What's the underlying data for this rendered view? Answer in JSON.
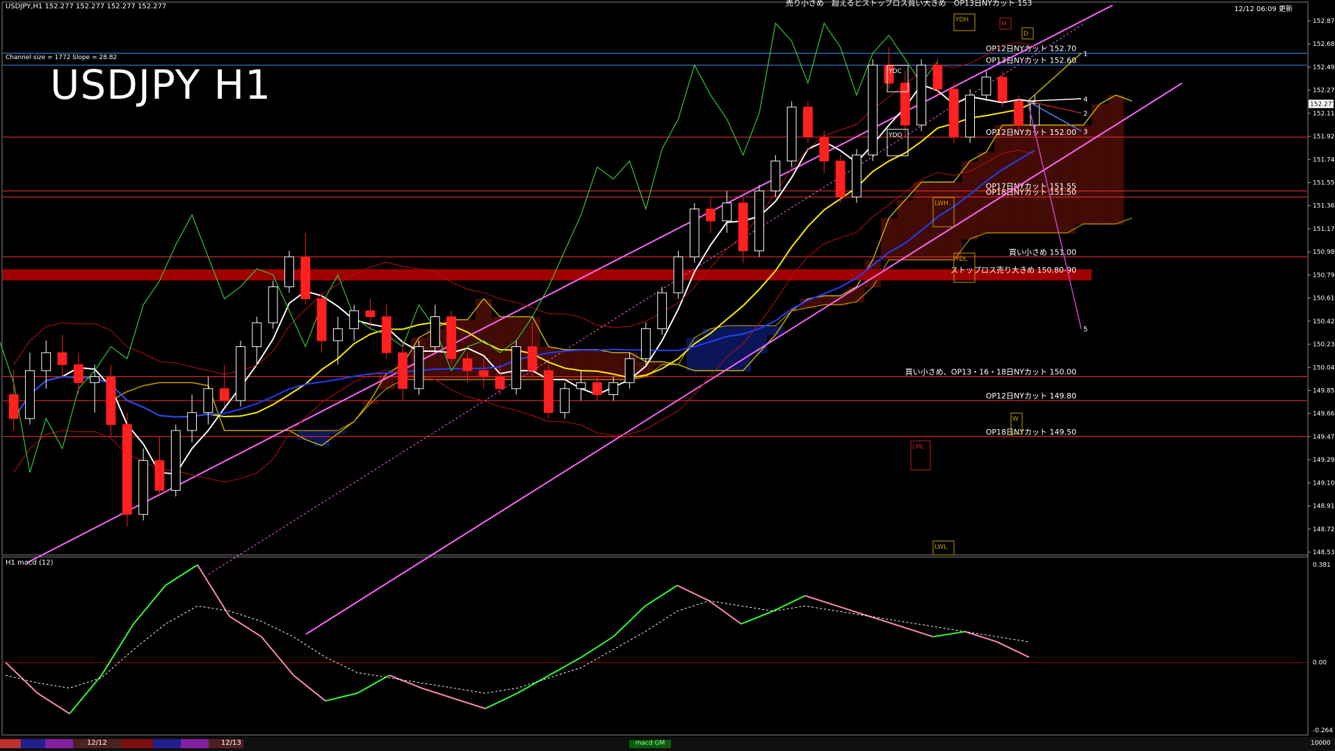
{
  "header": {
    "symbol_line": "USDJPY,H1  152.277 152.277 152.277 152.277",
    "channel_info": "Channel size = 1772 Slope = 28.82",
    "datetime_top_right": "12/12 06:09 更新",
    "title": "USDJPY H1",
    "top_banner": "売り小さめ　超えるとストップロス買い大きめ　OP13日NYカット 153"
  },
  "indicator": {
    "label": "H1  macd (12)",
    "yticks": [
      "0.381",
      "0.00",
      "-0.264"
    ],
    "footer_value": "10000"
  },
  "bottom_bar": {
    "date_labels": [
      "12/12",
      "12/13"
    ],
    "status_label": "macd GM"
  },
  "colors": {
    "background": "#000000",
    "bull_candle": "#ffffff",
    "bear_candle": "#ff2020",
    "channel": "#ff66ff",
    "ma_white": "#ffffff",
    "ma_yellow": "#ffee00",
    "ma_blue": "#2040ff",
    "chikou_green": "#33cc33",
    "macd_green": "#33ff33",
    "macd_pink": "#ff88bb"
  },
  "chart_data": {
    "type": "candlestick",
    "title": "USDJPY H1",
    "ylim": [
      148.535,
      152.97
    ],
    "yticks": [
      "152.870",
      "152.680",
      "152.495",
      "152.277",
      "152.115",
      "151.925",
      "151.740",
      "151.550",
      "151.360",
      "151.175",
      "150.985",
      "150.795",
      "150.610",
      "150.420",
      "150.230",
      "150.040",
      "149.855",
      "149.665",
      "149.475",
      "149.290",
      "149.100",
      "148.910",
      "148.725",
      "148.535"
    ],
    "current_price": "152.277",
    "candles": [
      {
        "o": 149.85,
        "h": 150.05,
        "l": 149.55,
        "c": 149.65
      },
      {
        "o": 149.65,
        "h": 150.2,
        "l": 149.6,
        "c": 150.05
      },
      {
        "o": 150.05,
        "h": 150.3,
        "l": 149.9,
        "c": 150.2
      },
      {
        "o": 150.2,
        "h": 150.35,
        "l": 150.0,
        "c": 150.1
      },
      {
        "o": 150.1,
        "h": 150.2,
        "l": 149.85,
        "c": 149.95
      },
      {
        "o": 149.95,
        "h": 150.1,
        "l": 149.7,
        "c": 150.0
      },
      {
        "o": 150.0,
        "h": 150.1,
        "l": 149.5,
        "c": 149.6
      },
      {
        "o": 149.6,
        "h": 149.7,
        "l": 148.75,
        "c": 148.85
      },
      {
        "o": 148.85,
        "h": 149.4,
        "l": 148.8,
        "c": 149.3
      },
      {
        "o": 149.3,
        "h": 149.5,
        "l": 149.0,
        "c": 149.05
      },
      {
        "o": 149.05,
        "h": 149.6,
        "l": 149.0,
        "c": 149.55
      },
      {
        "o": 149.55,
        "h": 149.85,
        "l": 149.45,
        "c": 149.7
      },
      {
        "o": 149.7,
        "h": 150.0,
        "l": 149.6,
        "c": 149.9
      },
      {
        "o": 149.9,
        "h": 150.1,
        "l": 149.75,
        "c": 149.8
      },
      {
        "o": 149.8,
        "h": 150.3,
        "l": 149.75,
        "c": 150.25
      },
      {
        "o": 150.25,
        "h": 150.5,
        "l": 150.1,
        "c": 150.45
      },
      {
        "o": 150.45,
        "h": 150.8,
        "l": 150.4,
        "c": 150.75
      },
      {
        "o": 150.75,
        "h": 151.05,
        "l": 150.7,
        "c": 151.0
      },
      {
        "o": 151.0,
        "h": 151.2,
        "l": 150.6,
        "c": 150.65
      },
      {
        "o": 150.65,
        "h": 150.7,
        "l": 150.2,
        "c": 150.3
      },
      {
        "o": 150.3,
        "h": 150.5,
        "l": 150.1,
        "c": 150.4
      },
      {
        "o": 150.4,
        "h": 150.6,
        "l": 150.3,
        "c": 150.55
      },
      {
        "o": 150.55,
        "h": 150.65,
        "l": 150.4,
        "c": 150.5
      },
      {
        "o": 150.5,
        "h": 150.6,
        "l": 150.15,
        "c": 150.2
      },
      {
        "o": 150.2,
        "h": 150.3,
        "l": 149.8,
        "c": 149.9
      },
      {
        "o": 149.9,
        "h": 150.3,
        "l": 149.85,
        "c": 150.25
      },
      {
        "o": 150.25,
        "h": 150.6,
        "l": 150.2,
        "c": 150.5
      },
      {
        "o": 150.5,
        "h": 150.55,
        "l": 150.1,
        "c": 150.15
      },
      {
        "o": 150.15,
        "h": 150.2,
        "l": 149.95,
        "c": 150.05
      },
      {
        "o": 150.05,
        "h": 150.15,
        "l": 149.9,
        "c": 150.0
      },
      {
        "o": 150.0,
        "h": 150.1,
        "l": 149.85,
        "c": 149.9
      },
      {
        "o": 149.9,
        "h": 150.3,
        "l": 149.85,
        "c": 150.25
      },
      {
        "o": 150.25,
        "h": 150.45,
        "l": 150.0,
        "c": 150.05
      },
      {
        "o": 150.05,
        "h": 150.1,
        "l": 149.65,
        "c": 149.7
      },
      {
        "o": 149.7,
        "h": 149.95,
        "l": 149.65,
        "c": 149.9
      },
      {
        "o": 149.9,
        "h": 150.05,
        "l": 149.8,
        "c": 149.95
      },
      {
        "o": 149.95,
        "h": 150.0,
        "l": 149.8,
        "c": 149.85
      },
      {
        "o": 149.85,
        "h": 150.0,
        "l": 149.8,
        "c": 149.95
      },
      {
        "o": 149.95,
        "h": 150.2,
        "l": 149.9,
        "c": 150.15
      },
      {
        "o": 150.15,
        "h": 150.45,
        "l": 150.1,
        "c": 150.4
      },
      {
        "o": 150.4,
        "h": 150.75,
        "l": 150.35,
        "c": 150.7
      },
      {
        "o": 150.7,
        "h": 151.05,
        "l": 150.65,
        "c": 151.0
      },
      {
        "o": 151.0,
        "h": 151.45,
        "l": 150.95,
        "c": 151.4
      },
      {
        "o": 151.4,
        "h": 151.5,
        "l": 151.2,
        "c": 151.3
      },
      {
        "o": 151.3,
        "h": 151.55,
        "l": 151.2,
        "c": 151.45
      },
      {
        "o": 151.45,
        "h": 151.5,
        "l": 150.95,
        "c": 151.05
      },
      {
        "o": 151.05,
        "h": 151.6,
        "l": 151.0,
        "c": 151.55
      },
      {
        "o": 151.55,
        "h": 151.85,
        "l": 151.5,
        "c": 151.8
      },
      {
        "o": 151.8,
        "h": 152.3,
        "l": 151.75,
        "c": 152.25
      },
      {
        "o": 152.25,
        "h": 152.3,
        "l": 151.95,
        "c": 152.0
      },
      {
        "o": 152.0,
        "h": 152.05,
        "l": 151.7,
        "c": 151.8
      },
      {
        "o": 151.8,
        "h": 151.85,
        "l": 151.45,
        "c": 151.5
      },
      {
        "o": 151.5,
        "h": 151.9,
        "l": 151.45,
        "c": 151.85
      },
      {
        "o": 151.85,
        "h": 152.65,
        "l": 151.8,
        "c": 152.6
      },
      {
        "o": 152.6,
        "h": 152.75,
        "l": 152.4,
        "c": 152.45
      },
      {
        "o": 152.45,
        "h": 152.55,
        "l": 152.0,
        "c": 152.1
      },
      {
        "o": 152.1,
        "h": 152.65,
        "l": 152.05,
        "c": 152.6
      },
      {
        "o": 152.6,
        "h": 152.65,
        "l": 152.35,
        "c": 152.4
      },
      {
        "o": 152.4,
        "h": 152.45,
        "l": 151.95,
        "c": 152.0
      },
      {
        "o": 152.0,
        "h": 152.4,
        "l": 151.95,
        "c": 152.35
      },
      {
        "o": 152.35,
        "h": 152.55,
        "l": 152.3,
        "c": 152.5
      },
      {
        "o": 152.5,
        "h": 152.55,
        "l": 152.25,
        "c": 152.3
      },
      {
        "o": 152.3,
        "h": 152.35,
        "l": 152.05,
        "c": 152.1
      },
      {
        "o": 152.1,
        "h": 152.35,
        "l": 152.05,
        "c": 152.28
      }
    ],
    "price_levels": [
      {
        "label": "OP12日NYカット 152.70",
        "price": 152.7,
        "color": "#4488ff"
      },
      {
        "label": "OP13日NYカット 152.60",
        "price": 152.6,
        "color": "#4488ff"
      },
      {
        "label": "OP12日NYカット 152.00",
        "price": 152.0,
        "color": "#ff3030"
      },
      {
        "label": "OP17日NYカット 151.55",
        "price": 151.55,
        "color": "#ff3030"
      },
      {
        "label": "OP18日NYカット 151.50",
        "price": 151.5,
        "color": "#ff3030"
      },
      {
        "label": "買い小さめ 151.00",
        "price": 151.0,
        "color": "#ff3030"
      },
      {
        "label": "ストップロス売り大きめ 150.80-90",
        "price": 150.85,
        "color": "#cc0000"
      },
      {
        "label": "買い小さめ、OP13・16・18日NYカット 150.00",
        "price": 150.0,
        "color": "#ff3030"
      },
      {
        "label": "OP12日NYカット 149.80",
        "price": 149.8,
        "color": "#ff3030"
      },
      {
        "label": "OP18日NYカット 149.50",
        "price": 149.5,
        "color": "#ff3030"
      }
    ],
    "projection_labels": [
      "1",
      "2",
      "3",
      "4",
      "5"
    ],
    "boxes": [
      "YDH",
      "YDC",
      "YDO",
      "YDL",
      "LWH",
      "LWL",
      "LML",
      "D",
      "M",
      "W"
    ],
    "macd": {
      "main": [
        0.0,
        -0.12,
        -0.2,
        -0.05,
        0.15,
        0.3,
        0.38,
        0.18,
        0.1,
        -0.05,
        -0.15,
        -0.12,
        -0.05,
        -0.1,
        -0.14,
        -0.18,
        -0.12,
        -0.05,
        0.02,
        0.1,
        0.22,
        0.3,
        0.24,
        0.15,
        0.2,
        0.26,
        0.22,
        0.18,
        0.14,
        0.1,
        0.12,
        0.08,
        0.02
      ],
      "signal": [
        -0.05,
        -0.08,
        -0.1,
        -0.06,
        0.05,
        0.15,
        0.22,
        0.2,
        0.16,
        0.1,
        0.02,
        -0.04,
        -0.06,
        -0.08,
        -0.1,
        -0.12,
        -0.1,
        -0.06,
        -0.02,
        0.05,
        0.12,
        0.2,
        0.24,
        0.22,
        0.2,
        0.22,
        0.2,
        0.18,
        0.16,
        0.14,
        0.12,
        0.1,
        0.08
      ]
    }
  }
}
